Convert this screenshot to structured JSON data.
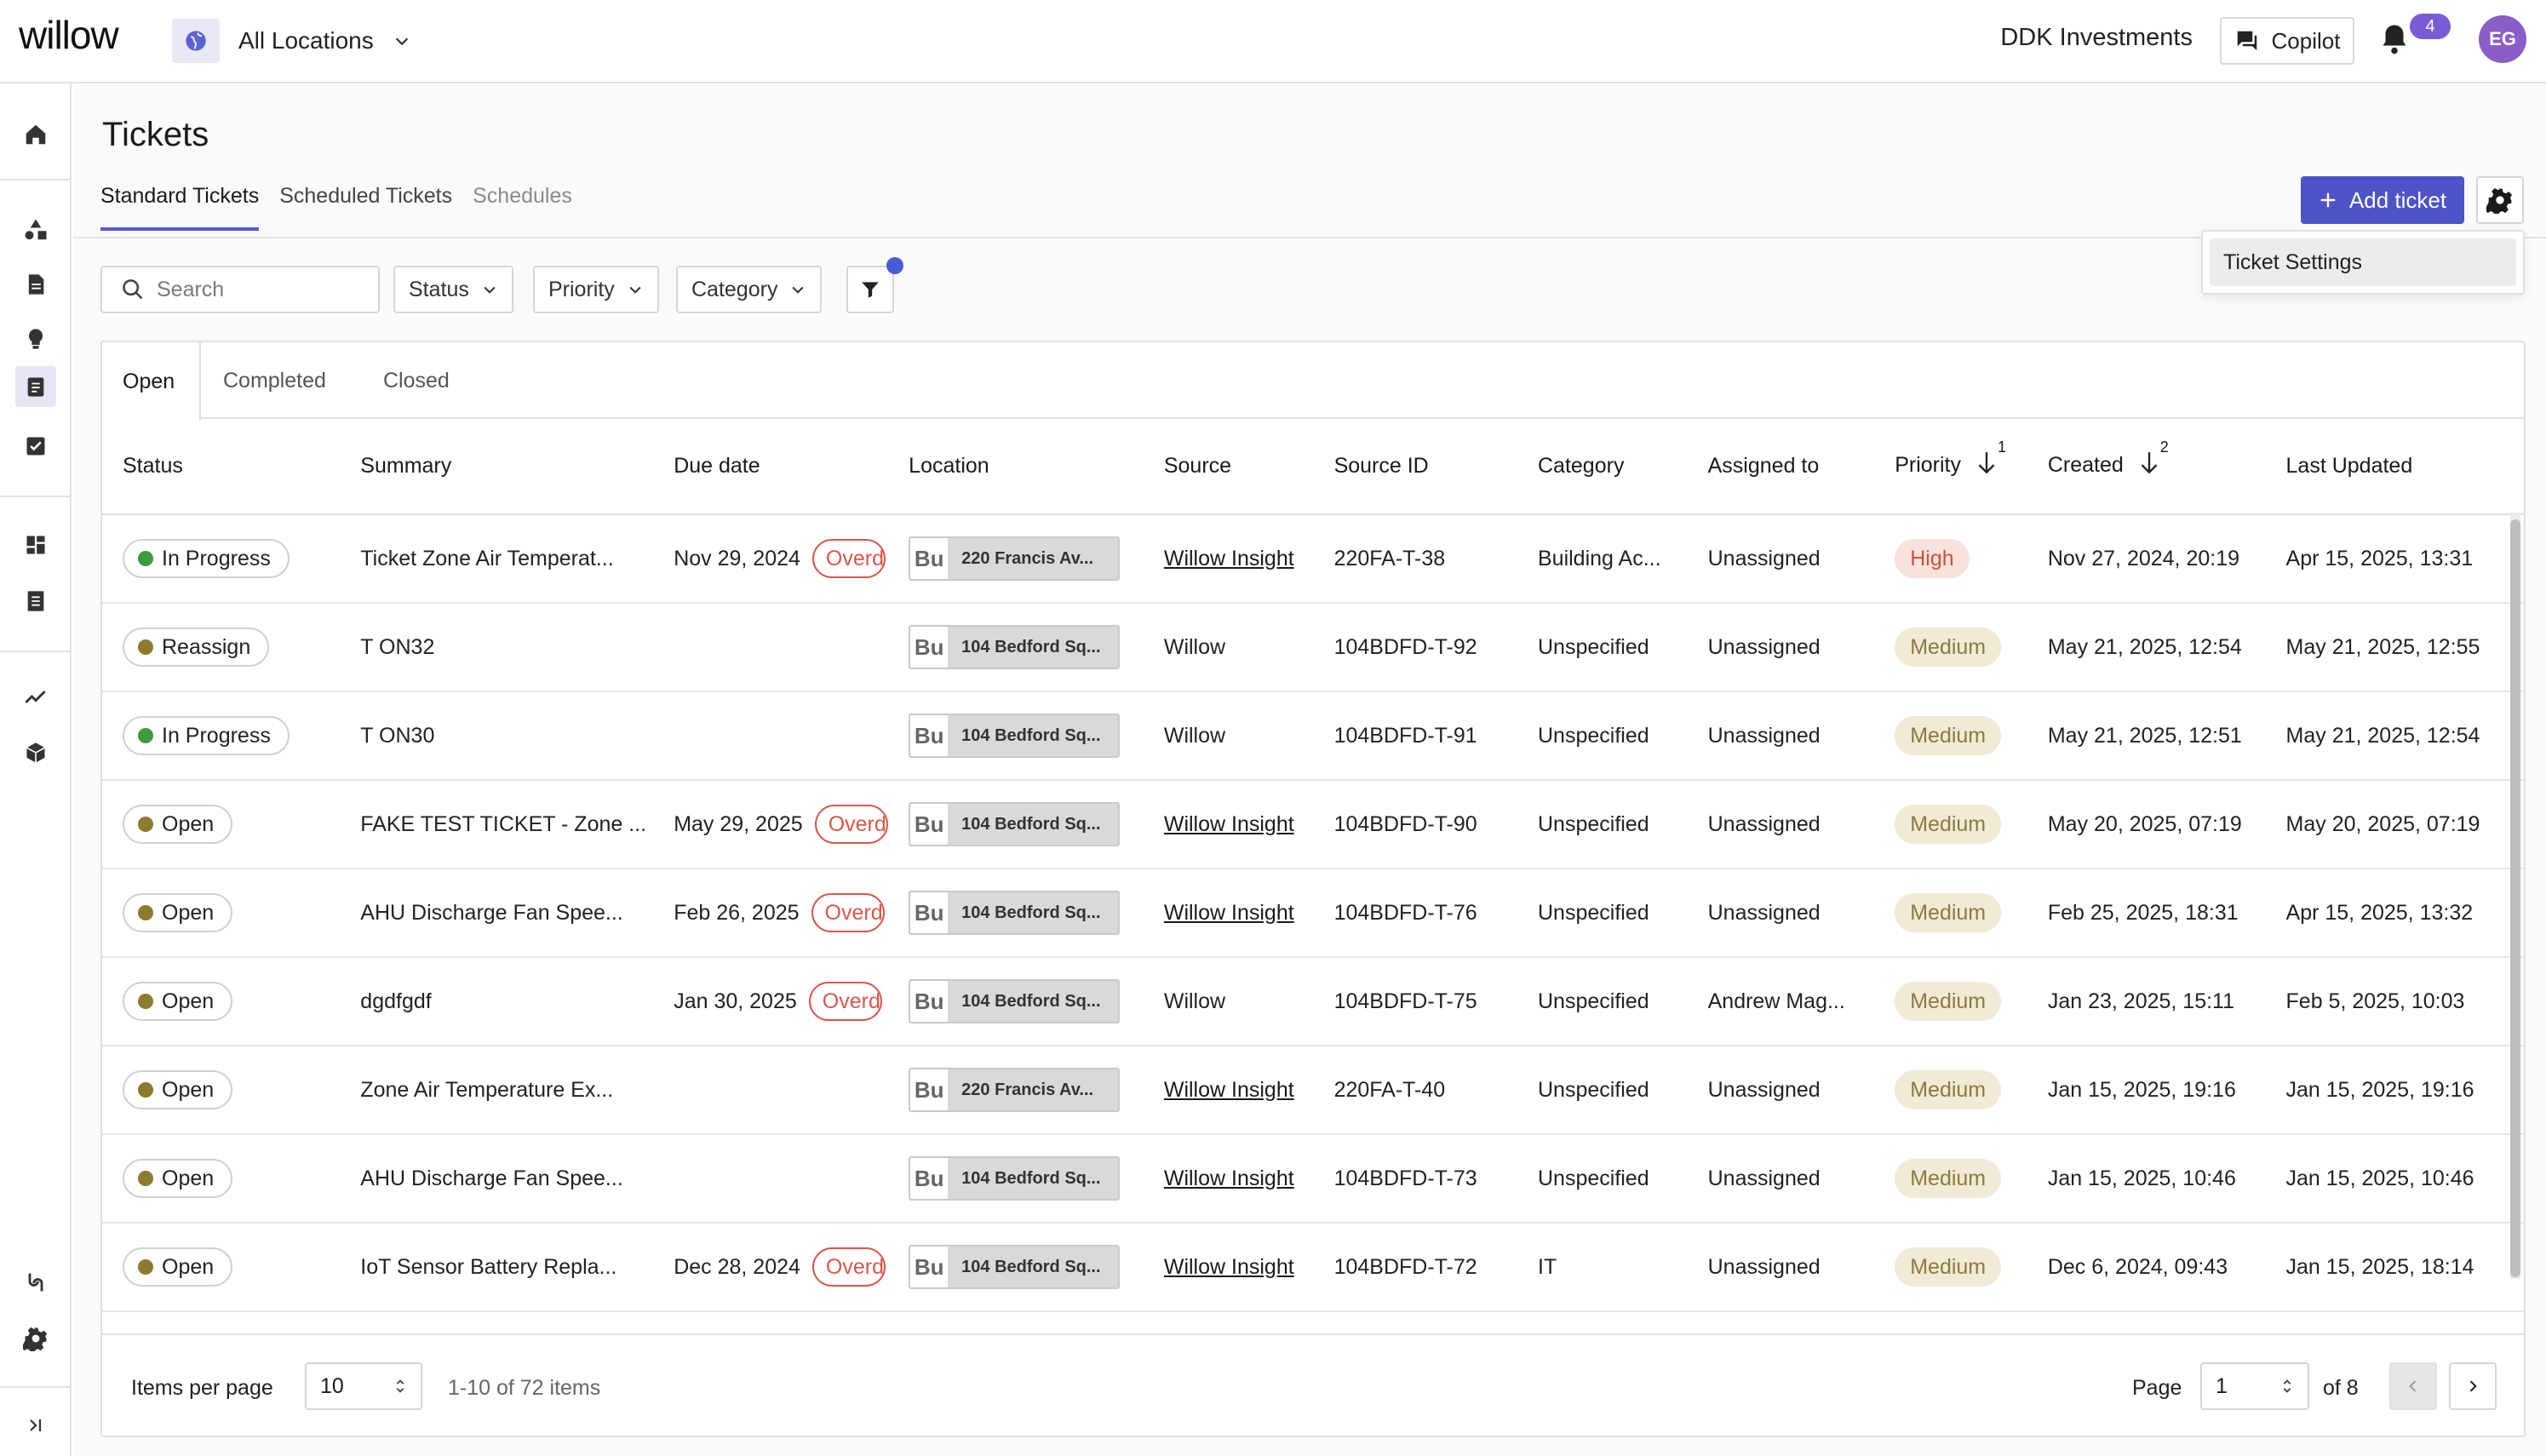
{
  "brand": {
    "logo": "willow"
  },
  "location_selector": {
    "label": "All Locations"
  },
  "header": {
    "company": "DDK Investments",
    "copilot_label": "Copilot",
    "notification_count": "4",
    "avatar_initials": "EG"
  },
  "page": {
    "title": "Tickets",
    "tabs": [
      {
        "label": "Standard Tickets",
        "active": true
      },
      {
        "label": "Scheduled Tickets",
        "active": false
      },
      {
        "label": "Schedules",
        "active": false
      }
    ],
    "add_ticket_label": "Add ticket",
    "settings_menu": {
      "item": "Ticket Settings"
    }
  },
  "filters": {
    "search_placeholder": "Search",
    "status_label": "Status",
    "priority_label": "Priority",
    "category_label": "Category"
  },
  "subtabs": [
    "Open",
    "Completed",
    "Closed"
  ],
  "table": {
    "columns": [
      "Status",
      "Summary",
      "Due date",
      "Location",
      "Source",
      "Source ID",
      "Category",
      "Assigned to",
      "Priority",
      "Created",
      "Last Updated"
    ],
    "priority_sort_index": "1",
    "created_sort_index": "2",
    "rows": [
      {
        "status": "In Progress",
        "status_color": "#3f9b3f",
        "summary": "Ticket Zone Air Temperat...",
        "due": "Nov 29, 2024",
        "overdue": "Overdue",
        "loc_code": "Bu",
        "location": "220 Francis Av...",
        "source": "Willow Insight",
        "source_link": true,
        "source_id": "220FA-T-38",
        "category": "Building Ac...",
        "assigned": "Unassigned",
        "priority": "High",
        "priority_level": "high",
        "created": "Nov 27, 2024, 20:19",
        "updated": "Apr 15, 2025, 13:31"
      },
      {
        "status": "Reassign",
        "status_color": "#8c7a2e",
        "summary": "T ON32",
        "due": "",
        "overdue": "",
        "loc_code": "Bu",
        "location": "104 Bedford Sq...",
        "source": "Willow",
        "source_link": false,
        "source_id": "104BDFD-T-92",
        "category": "Unspecified",
        "assigned": "Unassigned",
        "priority": "Medium",
        "priority_level": "medium",
        "created": "May 21, 2025, 12:54",
        "updated": "May 21, 2025, 12:55"
      },
      {
        "status": "In Progress",
        "status_color": "#3f9b3f",
        "summary": "T ON30",
        "due": "",
        "overdue": "",
        "loc_code": "Bu",
        "location": "104 Bedford Sq...",
        "source": "Willow",
        "source_link": false,
        "source_id": "104BDFD-T-91",
        "category": "Unspecified",
        "assigned": "Unassigned",
        "priority": "Medium",
        "priority_level": "medium",
        "created": "May 21, 2025, 12:51",
        "updated": "May 21, 2025, 12:54"
      },
      {
        "status": "Open",
        "status_color": "#8c7a2e",
        "summary": "FAKE TEST TICKET - Zone ...",
        "due": "May 29, 2025",
        "overdue": "Overdue",
        "loc_code": "Bu",
        "location": "104 Bedford Sq...",
        "source": "Willow Insight",
        "source_link": true,
        "source_id": "104BDFD-T-90",
        "category": "Unspecified",
        "assigned": "Unassigned",
        "priority": "Medium",
        "priority_level": "medium",
        "created": "May 20, 2025, 07:19",
        "updated": "May 20, 2025, 07:19"
      },
      {
        "status": "Open",
        "status_color": "#8c7a2e",
        "summary": "AHU Discharge Fan Spee...",
        "due": "Feb 26, 2025",
        "overdue": "Overdue",
        "loc_code": "Bu",
        "location": "104 Bedford Sq...",
        "source": "Willow Insight",
        "source_link": true,
        "source_id": "104BDFD-T-76",
        "category": "Unspecified",
        "assigned": "Unassigned",
        "priority": "Medium",
        "priority_level": "medium",
        "created": "Feb 25, 2025, 18:31",
        "updated": "Apr 15, 2025, 13:32"
      },
      {
        "status": "Open",
        "status_color": "#8c7a2e",
        "summary": "dgdfgdf",
        "due": "Jan 30, 2025",
        "overdue": "Overdue",
        "loc_code": "Bu",
        "location": "104 Bedford Sq...",
        "source": "Willow",
        "source_link": false,
        "source_id": "104BDFD-T-75",
        "category": "Unspecified",
        "assigned": "Andrew Mag...",
        "priority": "Medium",
        "priority_level": "medium",
        "created": "Jan 23, 2025, 15:11",
        "updated": "Feb 5, 2025, 10:03"
      },
      {
        "status": "Open",
        "status_color": "#8c7a2e",
        "summary": "Zone Air Temperature Ex...",
        "due": "",
        "overdue": "",
        "loc_code": "Bu",
        "location": "220 Francis Av...",
        "source": "Willow Insight",
        "source_link": true,
        "source_id": "220FA-T-40",
        "category": "Unspecified",
        "assigned": "Unassigned",
        "priority": "Medium",
        "priority_level": "medium",
        "created": "Jan 15, 2025, 19:16",
        "updated": "Jan 15, 2025, 19:16"
      },
      {
        "status": "Open",
        "status_color": "#8c7a2e",
        "summary": "AHU Discharge Fan Spee...",
        "due": "",
        "overdue": "",
        "loc_code": "Bu",
        "location": "104 Bedford Sq...",
        "source": "Willow Insight",
        "source_link": true,
        "source_id": "104BDFD-T-73",
        "category": "Unspecified",
        "assigned": "Unassigned",
        "priority": "Medium",
        "priority_level": "medium",
        "created": "Jan 15, 2025, 10:46",
        "updated": "Jan 15, 2025, 10:46"
      },
      {
        "status": "Open",
        "status_color": "#8c7a2e",
        "summary": "IoT Sensor Battery Repla...",
        "due": "Dec 28, 2024",
        "overdue": "Overdue",
        "loc_code": "Bu",
        "location": "104 Bedford Sq...",
        "source": "Willow Insight",
        "source_link": true,
        "source_id": "104BDFD-T-72",
        "category": "IT",
        "assigned": "Unassigned",
        "priority": "Medium",
        "priority_level": "medium",
        "created": "Dec 6, 2024, 09:43",
        "updated": "Jan 15, 2025, 18:14"
      }
    ]
  },
  "pagination": {
    "items_per_page_label": "Items per page",
    "items_per_page": "10",
    "range": "1-10 of 72 items",
    "page_label": "Page",
    "page": "1",
    "of_pages": "of 8"
  },
  "colors": {
    "accent": "#4d53c9",
    "avatar": "#8a5dc8",
    "overdue": "#d9574b"
  }
}
